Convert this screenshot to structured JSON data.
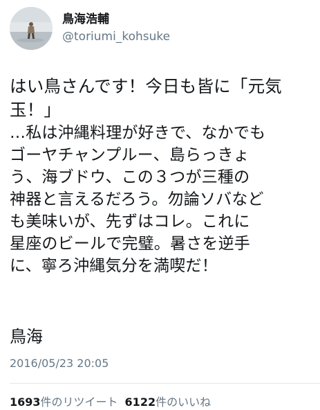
{
  "tweet": {
    "author": {
      "display_name": "鳥海浩輔",
      "handle": "@toriumi_kohsuke",
      "avatar": "avatar-photo"
    },
    "body_lines": [
      "はい鳥さんです！今日も皆に「元気",
      "玉！」",
      "…私は沖縄料理が好きで、なかでも",
      "ゴーヤチャンプルー、島らっきょ",
      "う、海ブドウ、この３つが三種の",
      "神器と言えるだろう。勿論ソバなど",
      "も美味いが、先ずはコレ。これに",
      "星座のビールで完璧。暑さを逆手",
      "に、寧ろ沖縄気分を満喫だ！"
    ],
    "signature": "鳥海",
    "timestamp": "2016/05/23 20:05",
    "stats": {
      "retweets_count": "1693",
      "retweets_label": "件のリツイート",
      "likes_count": "6122",
      "likes_label": "件のいいね"
    }
  }
}
